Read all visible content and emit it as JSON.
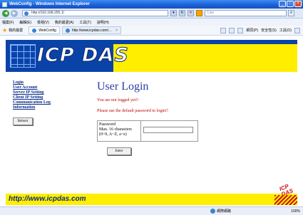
{
  "window": {
    "title": "WebConfig - Windows Internet Explorer",
    "buttons": {
      "minimize": "_",
      "maximize": "□",
      "close": "×"
    }
  },
  "addressbar": {
    "url": "http://192.168.255.1/",
    "search_placeholder": "Live"
  },
  "menubar": {
    "items": [
      "檔案(F)",
      "編輯(E)",
      "檢視(V)",
      "我的最愛(A)",
      "工具(T)",
      "說明(H)"
    ]
  },
  "favbar": {
    "favorites_label": "我的最愛",
    "tabs": [
      {
        "label": "WebConfig"
      },
      {
        "label": "http://www.icpdas.com/..."
      }
    ],
    "commands": [
      "網頁(P)",
      "安全性(S)",
      "工具(O)"
    ]
  },
  "banner": {
    "logo": "ICP DAS"
  },
  "sidebar": {
    "links": [
      "Login",
      "User Account",
      "Server IP Setting",
      "Client IP Setting",
      "Communication Log",
      "Information"
    ],
    "reboot_label": "Reboot"
  },
  "main": {
    "heading": "User Login",
    "not_logged": "You are not logged yet!!",
    "default_pw_msg": "Please use the default password to login!!",
    "password_label": "Password",
    "password_hint1": "Max. 16 characters",
    "password_hint2": "(0~9, A~Z, a~z)",
    "enter_label": "Enter"
  },
  "footer": {
    "url_text": "http://www.icpdas.com",
    "mark_text": "ICP DAS"
  },
  "statusbar": {
    "zone": "網際網路",
    "zoom": "100%"
  },
  "colors": {
    "banner_yellow": "#ffee00",
    "banner_blue": "#0a43a8",
    "heading_blue": "#2a3da8",
    "message_red": "#c00000",
    "link_blue": "#0a2a8a"
  }
}
